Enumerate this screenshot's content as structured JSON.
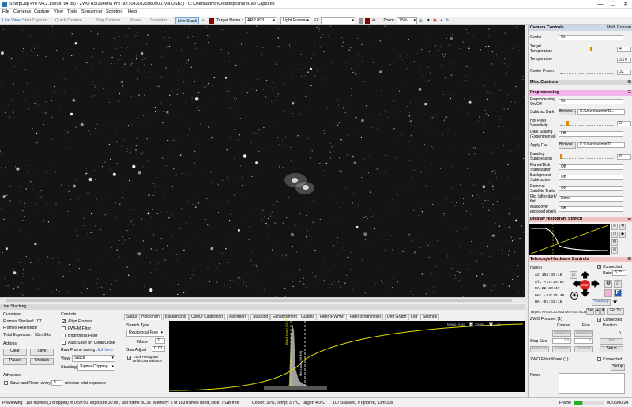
{
  "window": {
    "title": "SharpCap Pro (v4.2.15098, 64 bit) - ZWO ASI294MM Pro (ID:10430125080900, via USB3) - C:\\Users\\admin\\Desktop\\SharpCap Captures",
    "minimize": "—",
    "maximize": "☐",
    "close": "✕"
  },
  "menu": [
    "File",
    "Cameras",
    "Capture",
    "View",
    "Tools",
    "Sequencer",
    "Scripting",
    "Help"
  ],
  "toolbar": {
    "live_view": "Live View",
    "start_capture": "Start Capture",
    "quick_capture": "Quick Capture",
    "stop_capture": "Stop Capture",
    "pause": "Pause",
    "snapshot": "Snapshot",
    "live_stack": "Live Stack",
    "target_label": "Target Name :",
    "target_value": "ARP 093",
    "frame_type": "Light Frames",
    "fx_label": "FX",
    "zoom_label": "Zoom:",
    "zoom_value": "75%"
  },
  "camera_controls": {
    "header": "Camera Controls",
    "multi_column": "Multi Column",
    "cooler_label": "Cooler",
    "cooler_value": "On",
    "target_temp_label": "Target Temperature",
    "target_temp_value": "4",
    "temperature_label": "Temperature",
    "temperature_value": "3.70",
    "cooler_power_label": "Cooler Power",
    "cooler_power_value": "32"
  },
  "misc_controls": {
    "header": "Misc Controls"
  },
  "preprocessing": {
    "header": "Preprocessing",
    "rows": [
      {
        "label": "Preprocessing On/Off",
        "value": "On"
      },
      {
        "label": "Subtract Dark",
        "button": "Browse...",
        "value": "C:\\Users\\admin\\D..."
      },
      {
        "label": "Hot Pixel Sensitivity",
        "value": "5"
      },
      {
        "label": "Dark Scaling (Experimental)",
        "value": "Off"
      },
      {
        "label": "Apply Flat",
        "button": "Browse...",
        "value": "C:\\Users\\admin\\D..."
      },
      {
        "label": "Banding Suppression",
        "value": "0"
      },
      {
        "label": "Planet/Disk Stabilization",
        "value": "Off"
      },
      {
        "label": "Background Subtraction",
        "value": "Off"
      },
      {
        "label": "Remove Satellite Trails",
        "value": "Off"
      },
      {
        "label": "Flip (after dark/ flat)",
        "value": "None"
      },
      {
        "label": "Mask over exposed pixels",
        "value": "Off"
      }
    ]
  },
  "display_histogram": {
    "header": "Display Histogram Stretch"
  },
  "telescope": {
    "header": "Telescope Hardware Controls",
    "connected": "Connected",
    "mount": "Hubo-i",
    "az_label": "Az",
    "az": "155:39:46",
    "alt_label": "Alt",
    "alt": "+17:35:07",
    "ra_label": "RA",
    "ra": "22:30:47",
    "dec_label": "Dec",
    "dec": "-24:35:48",
    "ha_label": "HA",
    "ha": "-01:41:18",
    "rate_label": "Rate:",
    "rate": "8.2°",
    "stop": "STOP",
    "tracking": "Tracking",
    "target_line": "Target : RA=22:30:05.3 Dec=-24:46:28",
    "set": "Set",
    "goto": "Go To"
  },
  "focuser": {
    "header": "ZWO Focuser (1)",
    "connected": "Connected",
    "coarse": "Coarse",
    "fine": "Fine",
    "position": "Position",
    "negative": "Negative",
    "positive": "Positive",
    "position_value": "0",
    "step_size": "Step Size",
    "coarse_step": "500",
    "fine_step": "50",
    "stop": "Stop",
    "refocus": "Refocus",
    "setup": "Setup"
  },
  "filterwheel": {
    "header": "ZWO FilterWheel (1)",
    "connected": "Connected",
    "setup": "Setup"
  },
  "notes": {
    "label": "Notes"
  },
  "live_stack": {
    "header": "Live Stacking",
    "overview": "Overview",
    "frames_stacked_label": "Frames Stacked:",
    "frames_stacked": "107",
    "frames_rejected_label": "Frames Rejected:",
    "frames_rejected": "0",
    "total_exposure_label": "Total Exposure:",
    "total_exposure": "53m 30s",
    "actions": "Actions",
    "clear": "Clear",
    "save": "Save",
    "pause": "Pause",
    "unstack": "Unstack",
    "advanced": "Advanced",
    "save_reset_label": "Save and Reset every",
    "save_reset_value": "5",
    "save_reset_units": "minutes total exposure",
    "controls": "Controls",
    "align_frames": "Align Frames",
    "fwhm_filter": "FWHM Filter",
    "brightness_filter": "Brightness Filter",
    "auto_save": "Auto Save on Clear/Close",
    "raw_saving": "Raw Frame saving",
    "click_here": "click here",
    "view_label": "View",
    "view_value": "Stack",
    "stacking_label": "Stacking",
    "stacking_value": "Sigma Clipping"
  },
  "tabs": [
    "Status",
    "Histogram",
    "Background",
    "Colour Calibration",
    "Alignment",
    "Stacking",
    "Enhancement",
    "Guiding",
    "Filter (FWHM)",
    "Filter (Brightness)",
    "Drift Graph",
    "Log",
    "Settings"
  ],
  "histogram": {
    "stretch_type_label": "Stretch Type",
    "stretch_type": "Reciprocal Pow",
    "mode_label": "Mode",
    "mode_value": "2",
    "star_adjust_label": "Star Adjust",
    "star_adjust_value": "0.70",
    "track_label": "Track Histogram Drift/Color Balance",
    "mono_auto": "Mono, Auto",
    "zoom": "Zoom",
    "log": "Log",
    "black_line": "Black Level (22.0%)",
    "white_line": "Mid Level (36.4%)"
  },
  "status": {
    "preview": "Previewing : 198 frames (1 dropped) in 0:59:50, exposure 30.0s , last frame 30.3s",
    "memory": "Memory: 6 of 183 frames used, Disk: 7 GB free",
    "cooler": "Cooler: 32%, Temp: 3.7°C, Target: 4.0°C",
    "stacked": "107 Stacked, 0 Ignored, 53m 30s",
    "frame_label": "Frame",
    "frame_count": "00:06/00:24"
  },
  "colors": {
    "accent_pink": "#f4b6e8",
    "stop_red": "#e02020",
    "hist_yellow": "#e8e000"
  }
}
